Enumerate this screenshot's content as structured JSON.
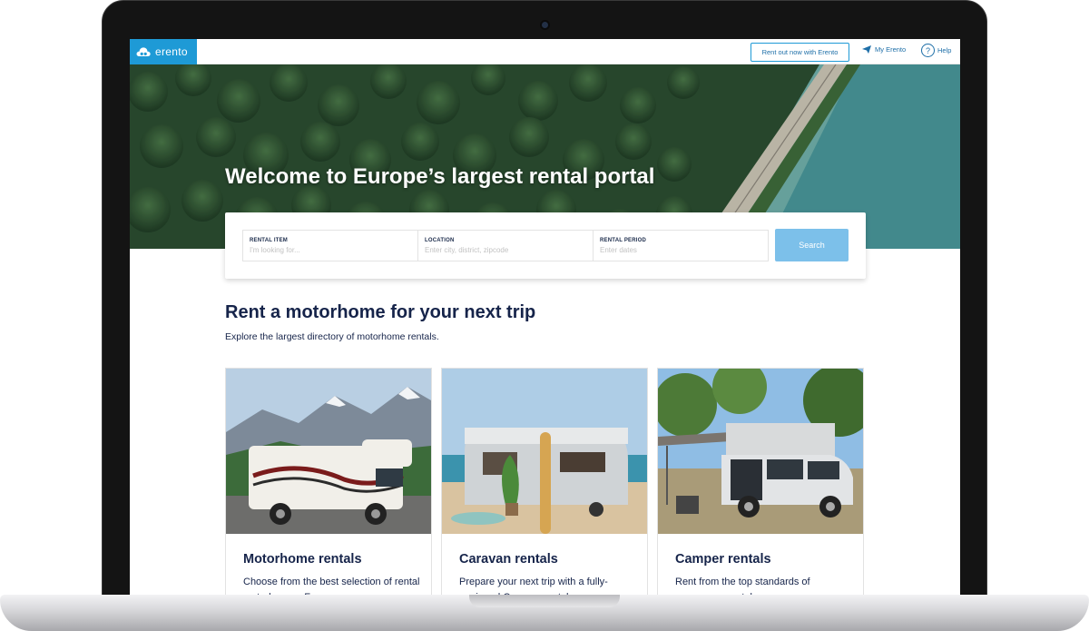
{
  "header": {
    "logo_text": "erento",
    "rent_out_label": "Rent out now with Erento",
    "my_erento_label": "My Erento",
    "help_label": "Help",
    "help_symbol": "?"
  },
  "hero": {
    "title": "Welcome to Europe’s largest rental portal"
  },
  "search": {
    "fields": [
      {
        "label": "RENTAL ITEM",
        "placeholder": "I'm looking for..."
      },
      {
        "label": "LOCATION",
        "placeholder": "Enter city, district, zipcode"
      },
      {
        "label": "RENTAL PERIOD",
        "placeholder": "Enter dates"
      }
    ],
    "button_label": "Search"
  },
  "section": {
    "title": "Rent a motorhome for your next trip",
    "subtitle": "Explore the largest directory of motorhome rentals."
  },
  "cards": [
    {
      "title": "Motorhome rentals",
      "text": "Choose from the best selection of rental motorhomes. From"
    },
    {
      "title": "Caravan rentals",
      "text": "Prepare your next trip with a fully-equipped Caravan rental"
    },
    {
      "title": "Camper rentals",
      "text": "Rent from the top standards of campervan rentals"
    }
  ],
  "colors": {
    "brand": "#1e9ad6",
    "navy": "#16244a",
    "search_button": "#7cc0ea"
  }
}
